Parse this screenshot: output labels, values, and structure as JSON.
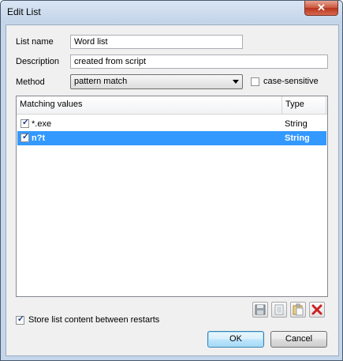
{
  "window": {
    "title": "Edit List"
  },
  "form": {
    "list_name_label": "List name",
    "list_name_value": "Word list",
    "description_label": "Description",
    "description_value": "created from script",
    "method_label": "Method",
    "method_value": "pattern match",
    "case_sensitive_label": "case-sensitive",
    "case_sensitive_checked": false
  },
  "grid": {
    "columns": [
      "Matching values",
      "Type"
    ],
    "rows": [
      {
        "value": "*.exe",
        "type": "String",
        "checked": true,
        "selected": false
      },
      {
        "value": "n?t",
        "type": "String",
        "checked": true,
        "selected": true
      }
    ]
  },
  "toolbar": {
    "icons": [
      "save-icon",
      "copy-icon",
      "paste-icon",
      "delete-icon"
    ]
  },
  "store": {
    "label": "Store list content between restarts",
    "checked": true
  },
  "buttons": {
    "ok": "OK",
    "cancel": "Cancel"
  },
  "colors": {
    "selection": "#3399ff",
    "delete": "#cc2222"
  }
}
